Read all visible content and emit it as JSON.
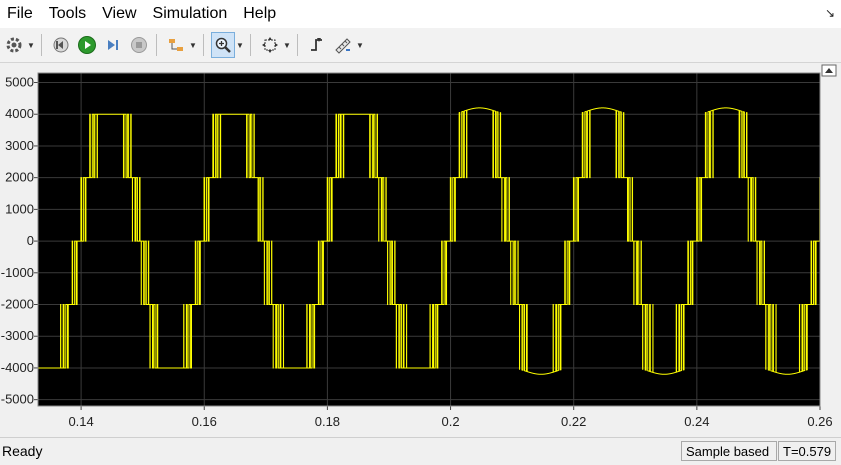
{
  "menu": [
    "File",
    "Tools",
    "View",
    "Simulation",
    "Help"
  ],
  "toolbar": {
    "icons": [
      "gear-icon",
      "step-back-icon",
      "run-icon",
      "step-forward-icon",
      "stop-icon",
      "signal-select-icon",
      "zoom-in-icon",
      "fit-to-view-icon",
      "triggers-icon",
      "measurements-icon"
    ]
  },
  "status": {
    "ready": "Ready",
    "sample_mode": "Sample based",
    "time": "T=0.579"
  },
  "colors": {
    "trace": "#ffff00",
    "plot_bg": "#000000",
    "axes_text": "#222222"
  },
  "chart_data": {
    "type": "line",
    "title": "",
    "xlabel": "",
    "ylabel": "",
    "xlim": [
      0.133,
      0.26
    ],
    "ylim": [
      -5200,
      5300
    ],
    "xticks": [
      0.14,
      0.16,
      0.18,
      0.2,
      0.22,
      0.24,
      0.26
    ],
    "yticks": [
      5000,
      4000,
      3000,
      2000,
      1000,
      0,
      -1000,
      -2000,
      -3000,
      -4000,
      -5000
    ],
    "grid": true,
    "period": 0.02,
    "series": [
      {
        "color": "#ffff00",
        "description": "PWM multilevel line voltage waveform",
        "envelope": [
          {
            "x_start": 0.133,
            "x_end": 0.2,
            "top": 4000,
            "bottom": -4000
          },
          {
            "x_start": 0.2,
            "x_end": 0.26,
            "top": 4200,
            "bottom": -4200
          }
        ],
        "levels": [
          -4000,
          -2000,
          0,
          2000,
          4000
        ]
      }
    ]
  }
}
